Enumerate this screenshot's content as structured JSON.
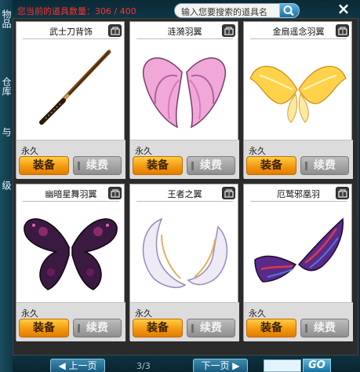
{
  "header": {
    "item_count_label": "您当前的道具数量：306 / 400",
    "search_placeholder": "输入您要搜索的道具名",
    "close_label": "×"
  },
  "left_tabs": [
    "物品",
    "仓库",
    "与",
    "级"
  ],
  "items": [
    {
      "name": "武士刀背饰",
      "duration": "永久",
      "equip_label": "装备",
      "renew_label": "续费",
      "icon": "katana-icon"
    },
    {
      "name": "涟漪羽翼",
      "duration": "永久",
      "equip_label": "装备",
      "renew_label": "续费",
      "icon": "pink-wings-icon"
    },
    {
      "name": "金扇遥念羽翼",
      "duration": "永久",
      "equip_label": "装备",
      "renew_label": "续费",
      "icon": "golden-wings-icon"
    },
    {
      "name": "幽暗星舞羽翼",
      "duration": "永久",
      "equip_label": "装备",
      "renew_label": "续费",
      "icon": "dark-butterfly-wings-icon"
    },
    {
      "name": "王者之翼",
      "duration": "永久",
      "equip_label": "装备",
      "renew_label": "续费",
      "icon": "white-wings-icon"
    },
    {
      "name": "厄鹫邪凰羽",
      "duration": "永久",
      "equip_label": "装备",
      "renew_label": "续费",
      "icon": "phoenix-wings-icon"
    }
  ],
  "pager": {
    "prev_label": "上一页",
    "page_indicator": "3/3",
    "next_label": "下一页",
    "go_label": "GO"
  },
  "colors": {
    "count_text": "#ff3030",
    "equip_button": "#f39a10",
    "renew_button": "#9e9e9e",
    "background": "#0c2f3d"
  }
}
